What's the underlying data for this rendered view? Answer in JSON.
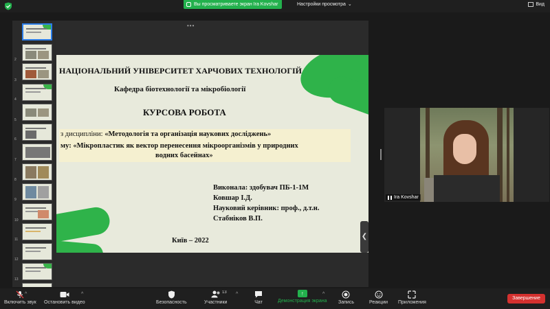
{
  "topbar": {
    "share_banner": "Вы просматриваете экран Ira Kovshar",
    "view_options": "Настройки просмотра",
    "view_label": "Вид"
  },
  "slide": {
    "university": "НАЦІОНАЛЬНИЙ УНІВЕРСИТЕТ ХАРЧОВИХ ТЕХНОЛОГІЙ",
    "department": "Кафедра біотехнології та мікробіології",
    "work_type": "КУРСОВА РОБОТА",
    "discipline_prefix": "з дисципліни: ",
    "discipline": "«Методологія та організація наукових досліджень»",
    "theme_line1": "му: «Мікропластик як вектор перенесення мікроорганізмів у природних",
    "theme_line2": "водних басейнах»",
    "author1": "Виконала: здобувач ПБ-1-1М",
    "author2": "Ковшар І.Д.",
    "author3": "Науковий керівник: проф., д.т.н.",
    "author4": "Стабніков В.П.",
    "city_year": "Київ – 2022"
  },
  "thumbnails": {
    "numbers": [
      "1",
      "2",
      "3",
      "4",
      "5",
      "6",
      "7",
      "8",
      "9",
      "10",
      "11",
      "12",
      "13"
    ]
  },
  "video": {
    "participant_name": "Ira Kovshar"
  },
  "toolbar": {
    "mute": "Включить звук",
    "stop_video": "Остановить видео",
    "security": "Безопасность",
    "participants": "Участники",
    "participants_count": "13",
    "chat": "Чат",
    "share": "Демонстрация экрана",
    "record": "Запись",
    "reactions": "Реакции",
    "apps": "Приложения",
    "end": "Завершение"
  },
  "colors": {
    "share_green": "#23b14d",
    "end_red": "#d4312f",
    "slide_bg": "#e8eadc",
    "leaf_green": "#2fb34a"
  }
}
